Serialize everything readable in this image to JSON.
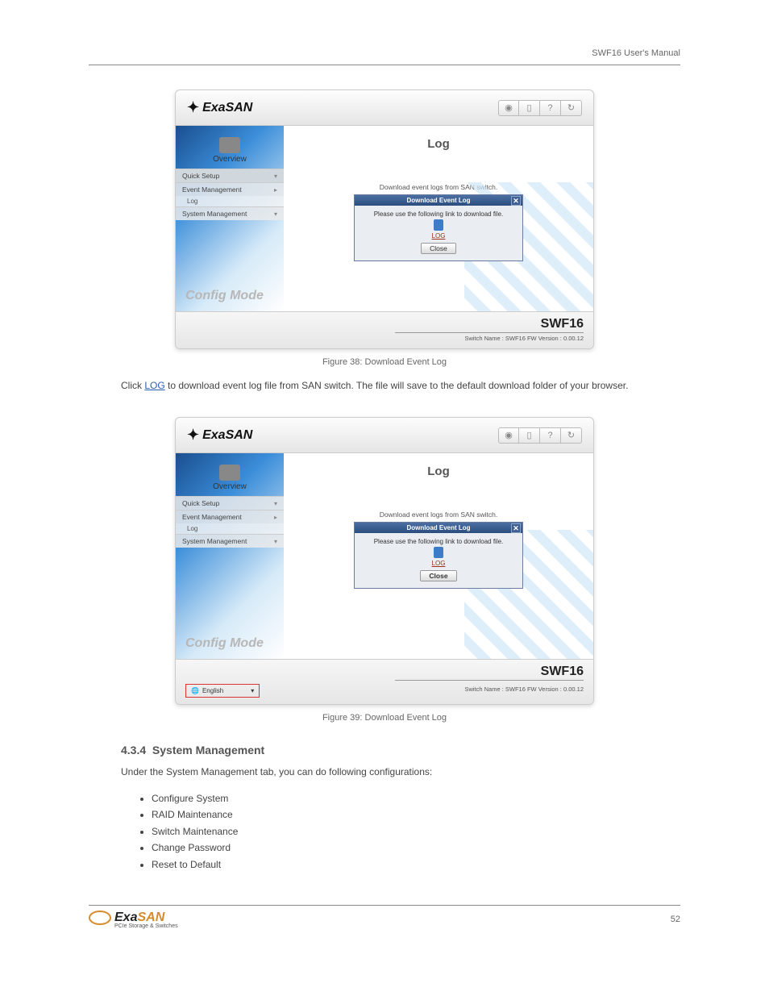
{
  "header": {
    "right": "SWF16 User's Manual"
  },
  "app": {
    "brand": "ExaSAN",
    "title": "Log",
    "desc": "Download event logs from SAN switch.",
    "dialog_title": "Download Event Log",
    "dialog_msg": "Please use the following link to download file.",
    "log_link": "LOG",
    "close": "Close",
    "mode": "Config Mode",
    "model": "SWF16",
    "status": "Switch Name : SWF16 FW Version : 0.00.12",
    "overview": "Overview",
    "nav": {
      "quick": "Quick Setup",
      "event": "Event Management",
      "log": "Log",
      "system": "System Management"
    },
    "lang": "English"
  },
  "captions": {
    "fig1": "Figure 38: Download Event Log",
    "fig2": "Figure 39: Download Event Log"
  },
  "paras": {
    "p1_a": "Click ",
    "p1_link": "LOG",
    "p1_b": " to download event log file from SAN switch. The file will save to the default download folder of your browser."
  },
  "section": {
    "num": "4.3.4",
    "title": "System Management",
    "intro": "Under the System Management tab, you can do following configurations:",
    "bullets": [
      "Configure System",
      "RAID Maintenance",
      "Switch Maintenance",
      "Change Password",
      "Reset to Default"
    ]
  },
  "footer": {
    "logo1": "Exa",
    "logo2": "SAN",
    "sub": "PCIe Storage & Switches",
    "page": "52"
  }
}
